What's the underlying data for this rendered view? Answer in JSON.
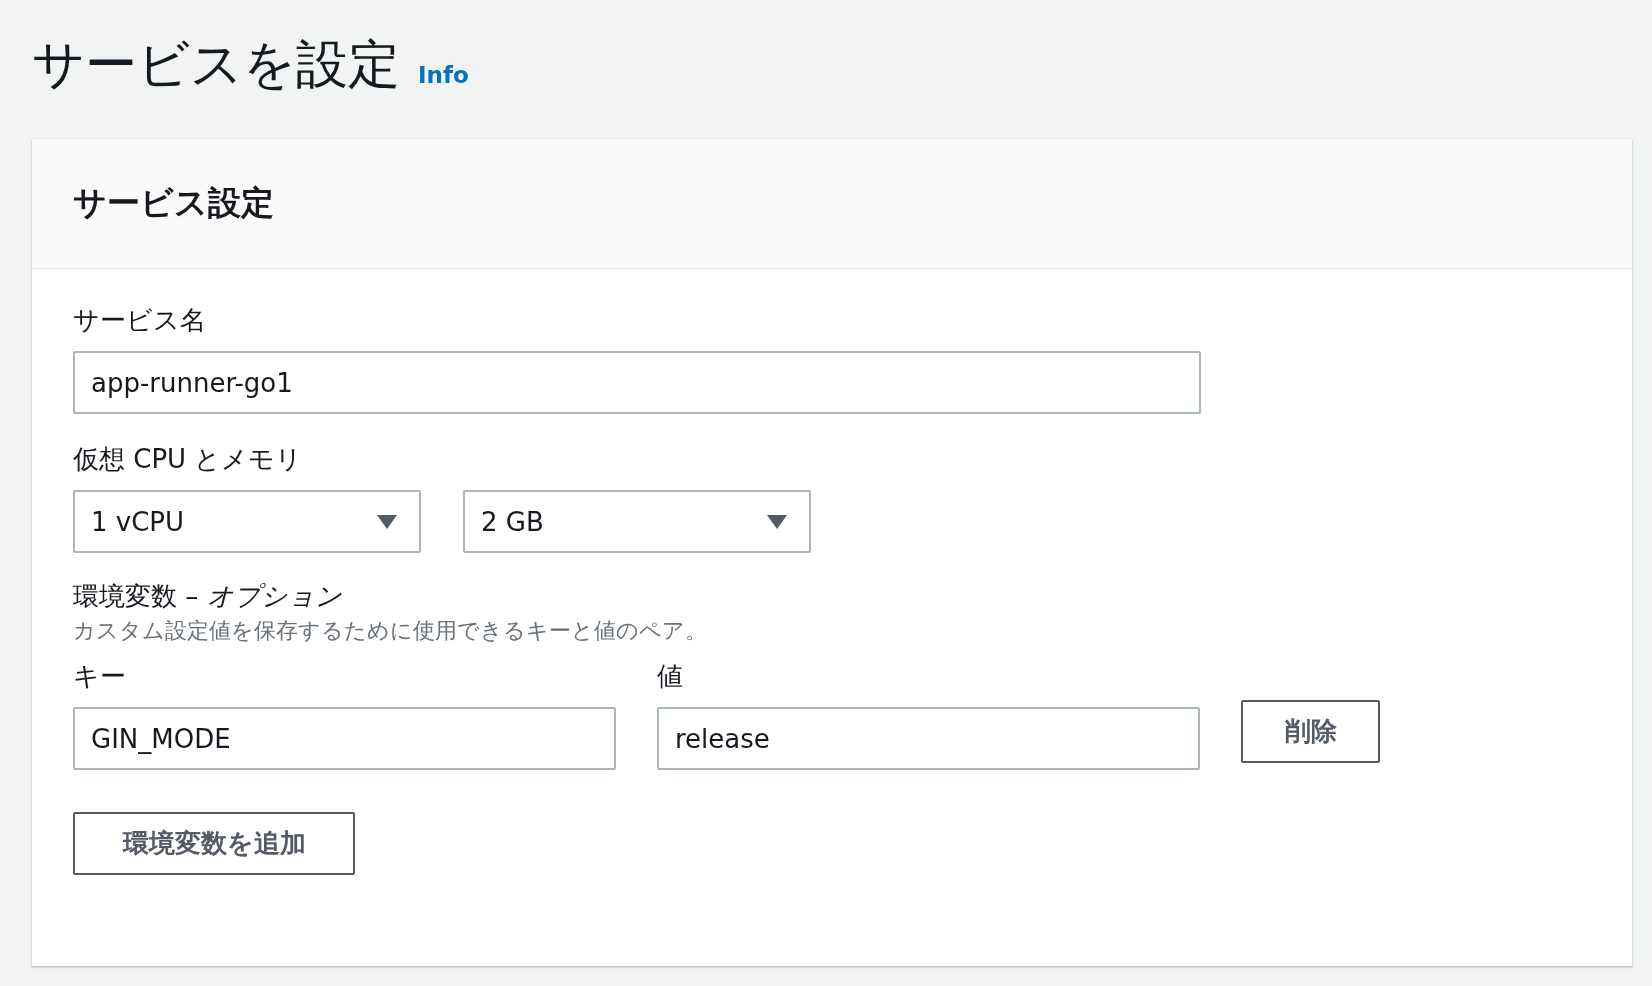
{
  "page": {
    "title": "サービスを設定",
    "info_link": "Info"
  },
  "card": {
    "title": "サービス設定",
    "service_name": {
      "label": "サービス名",
      "value": "app-runner-go1"
    },
    "cpu_memory": {
      "label": "仮想 CPU とメモリ",
      "selects": [
        {
          "value": "1 vCPU"
        },
        {
          "value": "2 GB"
        }
      ]
    },
    "env": {
      "label": "環境変数 – *オプション*",
      "description": "カスタム設定値を保存するために使用できるキーと値のペア。",
      "key_label": "キー",
      "value_label": "値",
      "rows": [
        {
          "key": "GIN_MODE",
          "value": "release",
          "remove_button": "削除"
        }
      ],
      "add_button": "環境変数を追加"
    }
  }
}
